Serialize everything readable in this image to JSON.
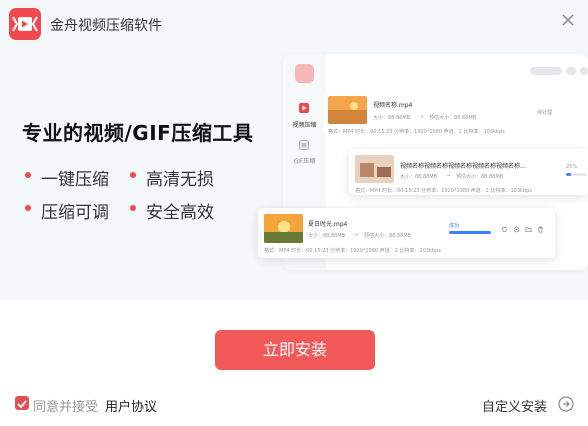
{
  "app": {
    "title": "金舟视频压缩软件"
  },
  "hero": {
    "headline": "专业的视频/GIF压缩工具",
    "features": [
      "一键压缩",
      "高清无损",
      "压缩可调",
      "安全高效"
    ]
  },
  "preview": {
    "nav": [
      {
        "label": "视频压缩",
        "icon": "video-play-icon"
      },
      {
        "label": "GIF压缩",
        "icon": "gif-icon"
      }
    ],
    "files": [
      {
        "name": "视频名称.mp4",
        "before": "大小：88.88MB",
        "after": "预估大小：88.88MB",
        "meta": "格式：MP4    时长：00:15:23    分辨率：1920*1080    声道：2    比特率：103kbps",
        "status": "待处理"
      },
      {
        "name": "视频名称视频名称视频名称视频名称视频名称...",
        "before": "大小：88.88MB",
        "after": "预估大小：88.88MB",
        "meta": "格式：MP4    时长：00:15:23    分辨率：1920*1080    声道：2    比特率：103kbps",
        "status": "25%",
        "progress": 0.25
      },
      {
        "name": "夏日时光.mp4",
        "before": "大小：88.88MB",
        "after": "预估大小：88.88MB",
        "meta": "格式：MP4    时长：00:15:23    分辨率：1920*1080    声道：2    比特率：103kbps",
        "status": "成功",
        "progress": 1.0
      }
    ]
  },
  "install": {
    "button": "立即安装"
  },
  "agreement": {
    "prefix": "同意并接受",
    "link": "用户协议",
    "checked": true
  },
  "custom_install": {
    "label": "自定义安装"
  },
  "colors": {
    "brand": "#f0494e",
    "button": "#f25a5a",
    "progress": "#3b82f6",
    "hero_bg": "#f4f8fb"
  }
}
